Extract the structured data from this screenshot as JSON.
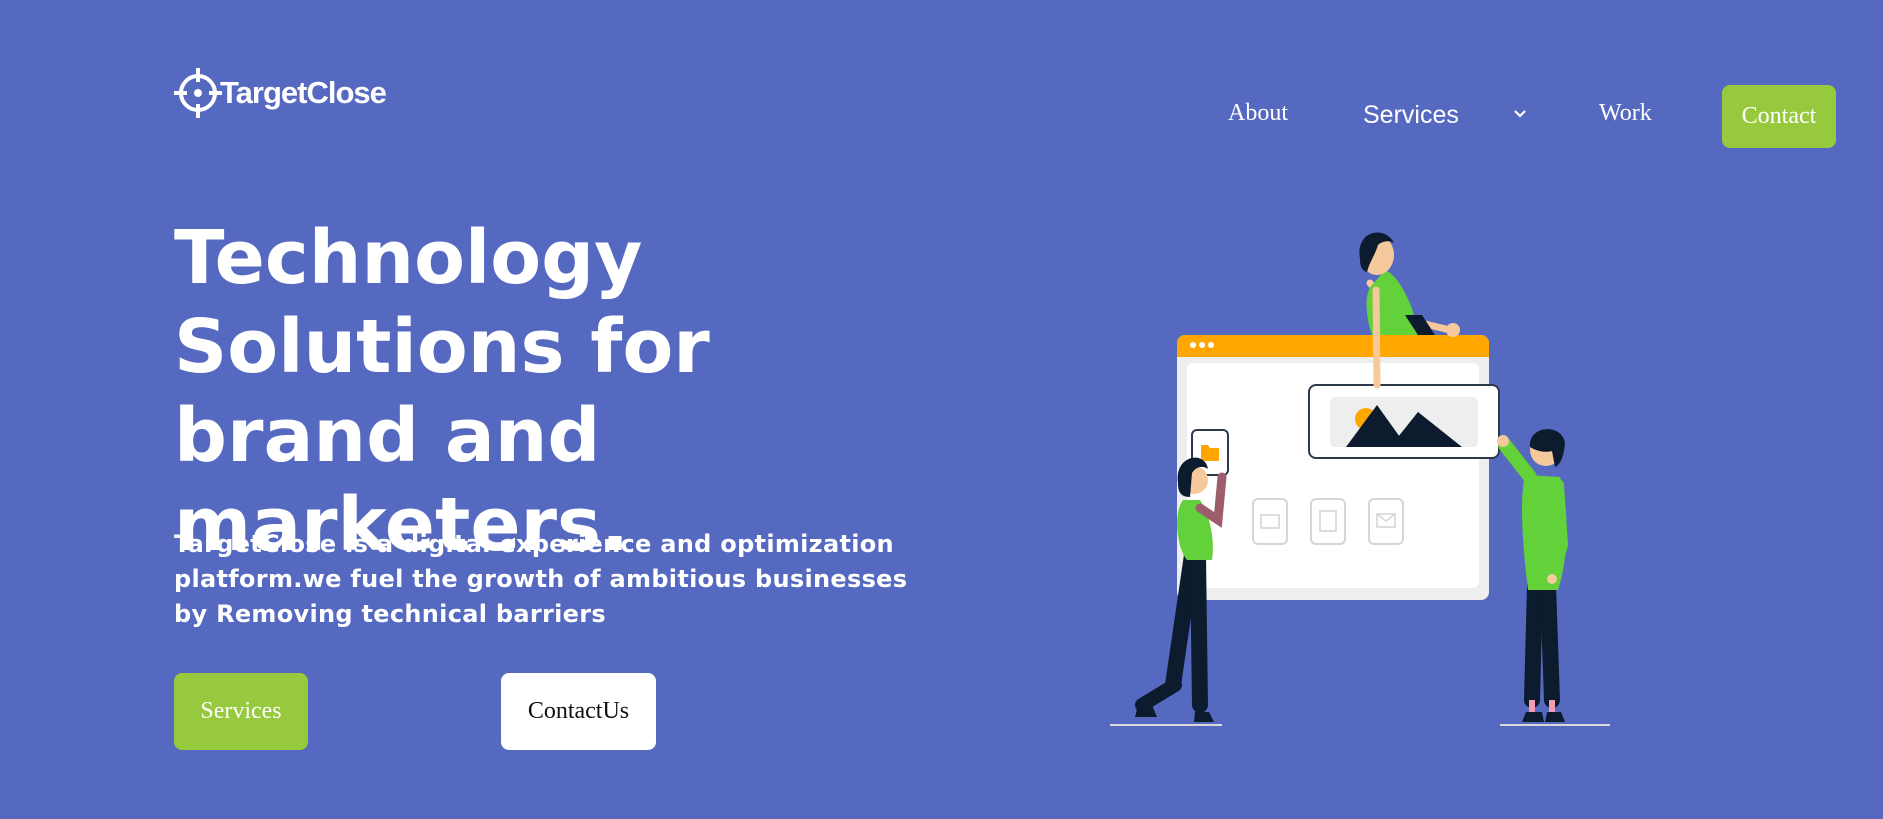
{
  "header": {
    "logo_text": "TargetClose",
    "logo_icon": "crosshair-target-icon",
    "nav": {
      "about": "About",
      "services": "Services",
      "work": "Work",
      "contact": "Contact"
    }
  },
  "hero": {
    "headline": "Technology Solutions for brand and marketers.",
    "description": "TargetClose is a digital experience and optimization platform.we fuel the growth of ambitious businesses by Removing technical barriers",
    "buttons": {
      "services": "Services",
      "contact": "ContactUs"
    }
  },
  "colors": {
    "background": "#5569c1",
    "accent_green": "#96c93d",
    "browser_bar": "#ffa600"
  }
}
